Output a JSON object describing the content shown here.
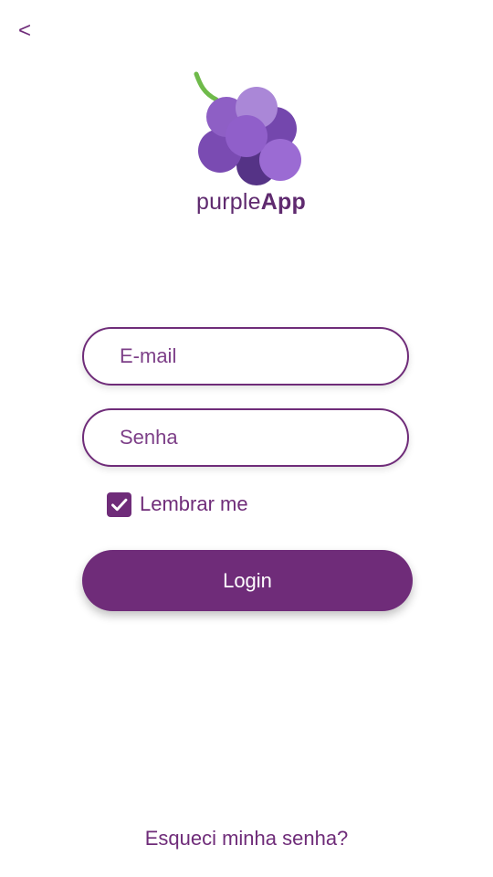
{
  "header": {
    "back_label": "<"
  },
  "brand": {
    "logo_icon": "grape-icon",
    "name_regular": "purple",
    "name_bold": "App",
    "color": "#6f2c79"
  },
  "form": {
    "email_placeholder": "E-mail",
    "password_placeholder": "Senha",
    "remember_label": "Lembrar me",
    "remember_checked": true,
    "login_label": "Login"
  },
  "footer": {
    "forgot_label": "Esqueci minha senha?"
  }
}
